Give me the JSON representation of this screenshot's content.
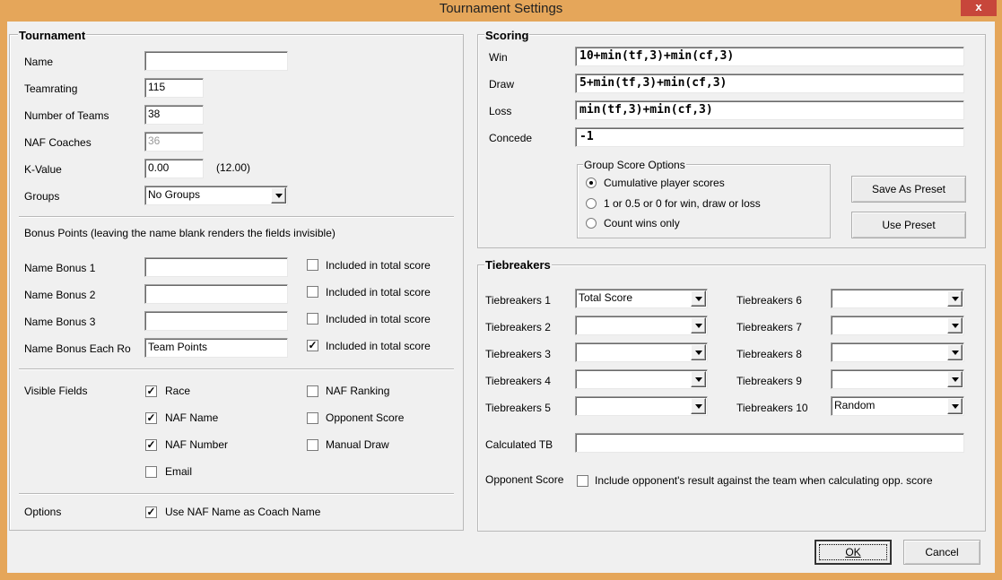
{
  "window": {
    "title": "Tournament Settings",
    "close_glyph": "x"
  },
  "tournament": {
    "title": "Tournament",
    "name": {
      "label": "Name",
      "value": ""
    },
    "teamrating": {
      "label": "Teamrating",
      "value": "115"
    },
    "num_teams": {
      "label": "Number of Teams",
      "value": "38"
    },
    "naf_coaches": {
      "label": "NAF Coaches",
      "value": "36"
    },
    "k_value": {
      "label": "K-Value",
      "value": "0.00",
      "hint": "(12.00)"
    },
    "groups": {
      "label": "Groups",
      "value": "No Groups"
    },
    "bonus_header": "Bonus Points (leaving the name blank renders the fields invisible)",
    "bonus": [
      {
        "label": "Name Bonus 1",
        "value": "",
        "check_label": "Included in total score",
        "checked": false
      },
      {
        "label": "Name Bonus 2",
        "value": "",
        "check_label": "Included in total score",
        "checked": false
      },
      {
        "label": "Name Bonus 3",
        "value": "",
        "check_label": "Included in total score",
        "checked": false
      },
      {
        "label": "Name Bonus Each Ro",
        "value": "Team Points",
        "check_label": "Included in total score",
        "checked": true
      }
    ],
    "visible_fields": {
      "label": "Visible Fields",
      "items": [
        {
          "label": "Race",
          "checked": true
        },
        {
          "label": "NAF Name",
          "checked": true
        },
        {
          "label": "NAF Number",
          "checked": true
        },
        {
          "label": "Email",
          "checked": false
        },
        {
          "label": "NAF Ranking",
          "checked": false
        },
        {
          "label": "Opponent Score",
          "checked": false
        },
        {
          "label": "Manual Draw",
          "checked": false
        }
      ]
    },
    "options": {
      "label": "Options",
      "item": {
        "label": "Use NAF Name as Coach Name",
        "checked": true
      }
    }
  },
  "scoring": {
    "title": "Scoring",
    "rows": [
      {
        "label": "Win",
        "value": "10+min(tf,3)+min(cf,3)"
      },
      {
        "label": "Draw",
        "value": "5+min(tf,3)+min(cf,3)"
      },
      {
        "label": "Loss",
        "value": "min(tf,3)+min(cf,3)"
      },
      {
        "label": "Concede",
        "value": "-1"
      }
    ],
    "group_options": {
      "title": "Group Score Options",
      "items": [
        {
          "label": "Cumulative player scores",
          "selected": true
        },
        {
          "label": "1 or 0.5 or 0 for win, draw or loss",
          "selected": false
        },
        {
          "label": "Count wins only",
          "selected": false
        }
      ]
    },
    "save_preset": "Save As Preset",
    "use_preset": "Use Preset"
  },
  "tiebreakers": {
    "title": "Tiebreakers",
    "left": [
      {
        "label": "Tiebreakers 1",
        "value": "Total Score"
      },
      {
        "label": "Tiebreakers 2",
        "value": ""
      },
      {
        "label": "Tiebreakers 3",
        "value": ""
      },
      {
        "label": "Tiebreakers 4",
        "value": ""
      },
      {
        "label": "Tiebreakers 5",
        "value": ""
      }
    ],
    "right": [
      {
        "label": "Tiebreakers 6",
        "value": ""
      },
      {
        "label": "Tiebreakers 7",
        "value": ""
      },
      {
        "label": "Tiebreakers 8",
        "value": ""
      },
      {
        "label": "Tiebreakers 9",
        "value": ""
      },
      {
        "label": "Tiebreakers 10",
        "value": "Random"
      }
    ],
    "calculated": {
      "label": "Calculated TB",
      "value": ""
    },
    "opponent_score": {
      "label": "Opponent Score",
      "check_label": "Include opponent's result against the team when calculating opp. score",
      "checked": false
    }
  },
  "footer": {
    "ok": "OK",
    "cancel": "Cancel"
  }
}
